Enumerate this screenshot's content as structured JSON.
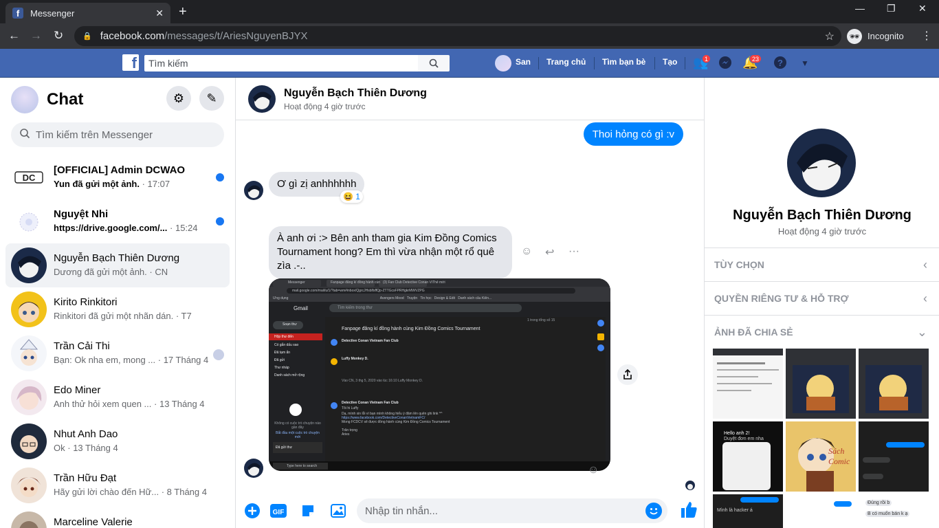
{
  "browser": {
    "tab_title": "Messenger",
    "url_host": "facebook.com",
    "url_path": "/messages/t/AriesNguyenBJYX",
    "incognito_label": "Incognito"
  },
  "fb": {
    "logo": "f",
    "search_placeholder": "Tìm kiếm",
    "profile_name": "San",
    "nav": [
      "Trang chủ",
      "Tìm bạn bè",
      "Tạo"
    ],
    "friend_badge": "1",
    "notif_badge": "23"
  },
  "left": {
    "title": "Chat",
    "search_placeholder": "Tìm kiếm trên Messenger",
    "conversations": [
      {
        "name": "[OFFICIAL] Admin DCWAO",
        "preview": "Yun đã gửi một ảnh.",
        "time": "· 17:07",
        "unread": true
      },
      {
        "name": "Nguyệt Nhi",
        "preview": "https://drive.google.com/...",
        "time": "· 15:24",
        "unread": true
      },
      {
        "name": "Nguyễn Bạch Thiên Dương",
        "preview": "Dương đã gửi một ảnh.",
        "time": "· CN",
        "unread": false
      },
      {
        "name": "Kirito Rinkitori",
        "preview": "Rinkitori đã gửi một nhãn dán.",
        "time": "· T7",
        "unread": false
      },
      {
        "name": "Trần Cải Thi",
        "preview": "Bạn: Ok nha em, mong ...",
        "time": "· 17 Tháng 4",
        "unread": false
      },
      {
        "name": "Edo Miner",
        "preview": "Anh thử hỏi xem quen ...",
        "time": "· 13 Tháng 4",
        "unread": false
      },
      {
        "name": "Nhut Anh Dao",
        "preview": "Ok",
        "time": "· 13 Tháng 4",
        "unread": false
      },
      {
        "name": "Trần Hữu Đạt",
        "preview": "Hãy gửi lời chào đến Hữ...",
        "time": "· 8 Tháng 4",
        "unread": false
      },
      {
        "name": "Marceline Valerie",
        "preview": "",
        "time": "",
        "unread": false
      }
    ]
  },
  "thread": {
    "name": "Nguyễn Bạch Thiên Dương",
    "status": "Hoạt động 4 giờ trước",
    "messages": {
      "out1": "Thoi hỏng có gì :v",
      "in1": "Ơ gì zị anhhhhhh",
      "in1_reaction": "😆 1",
      "in2": "À anh ơi :> Bên anh tham gia Kim Đồng Comics Tournament hong? Em thì vừa nhận một rổ quê zìa .-.."
    },
    "composer_placeholder": "Nhập tin nhắn...",
    "gif_label": "GIF"
  },
  "shot": {
    "tabs": [
      "Messenger",
      "Fanpage đăng kí đồng hành cùn",
      "(3) Fan Club Detective Conan Vi",
      "Thẻ mới"
    ],
    "url": "mail.google.com/mail/u/1/?tab=wm#inbox/QgrcJHsblfsffQp-ZTTGcsFPRHgkrMWVZPG",
    "bookmarks": [
      "Ứng dụng",
      "Avengers Mood",
      "Truyện",
      "Tin học",
      "Design & Edit",
      "Danh sách câu Kiên..."
    ],
    "app": "Gmail",
    "search": "Tìm kiếm trong thư",
    "compose": "Soạn thư",
    "folders": [
      "Hộp thư đến",
      "Có gắn dấu sao",
      "Đã tạm ẩn",
      "Đã gửi",
      "Thư nháp",
      "Danh sách mở rộng"
    ],
    "subject": "Fanpage đăng kí đồng hành cùng Kim Đồng Comics Tournament",
    "sender1": "Detective Conan Vietnam Fan Club",
    "sender2": "Luffy Monkey D.",
    "sender3": "Detective Conan Vietnam Fan Club",
    "line1": "Tôi hi Luffy",
    "line2": "Dạ, mình xin lỗi vì bạn mình không hiểu ý đâm lên quên ghi link ^^",
    "line3": "https://www.facebook.com/DetectiveConanVietnamFC/",
    "line4": "Mong FCDCV sẽ được đồng hành cùng Kim Đồng Comics Tournament",
    "line5": "Trân trọng",
    "line6": "Aries",
    "reply_label": "Vào CN, 3 thg 5, 2020 vào lúc 16:10 Luffy Monkey D.",
    "count": "1 trong tổng số 15",
    "taskbar_search": "Type here to search",
    "hangouts_text": "Không có cuộc trò chuyện nào gần đây",
    "hangouts_link": "Bắt đầu một cuộc trò chuyện mới",
    "sent_label": "Đã gửi thư"
  },
  "right": {
    "name": "Nguyễn Bạch Thiên Dương",
    "status": "Hoạt động 4 giờ trước",
    "sections": [
      "TÙY CHỌN",
      "QUYỀN RIÊNG TƯ & HỖ TRỢ",
      "ẢNH ĐÃ CHIA SẺ"
    ],
    "thumb_text": {
      "t1": "Hello anh 2!",
      "t2": "Duyệt đơn em nha",
      "t3": "Đúng rồi b",
      "t4": "B có muốn bán k ạ",
      "t5": "Mình là hacker á",
      "t6": "Sách Comic"
    }
  },
  "colors": {
    "fb_blue": "#4267b2",
    "messenger_blue": "#0084ff",
    "unread_dot": "#1877f2"
  }
}
